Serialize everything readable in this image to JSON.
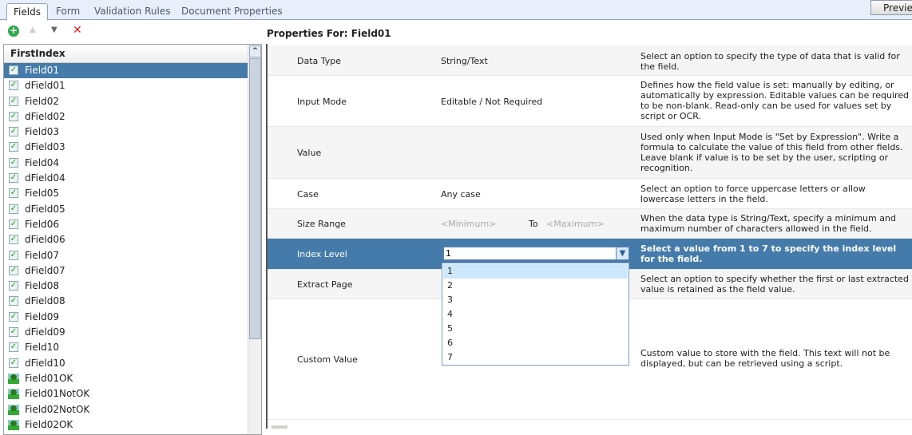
{
  "tabs": [
    {
      "label": "Fields",
      "active": true
    },
    {
      "label": "Form"
    },
    {
      "label": "Validation Rules"
    },
    {
      "label": "Document Properties"
    }
  ],
  "preview_label": "Preview",
  "toolbar": {
    "add": "add-icon",
    "up": "move-up-icon",
    "down": "move-down-icon",
    "delete": "delete-icon"
  },
  "list": {
    "header": "FirstIndex",
    "items": [
      {
        "label": "Field01",
        "type": "check",
        "selected": true
      },
      {
        "label": "dField01",
        "type": "check"
      },
      {
        "label": "Field02",
        "type": "check"
      },
      {
        "label": "dField02",
        "type": "check"
      },
      {
        "label": "Field03",
        "type": "check"
      },
      {
        "label": "dField03",
        "type": "check"
      },
      {
        "label": "Field04",
        "type": "check"
      },
      {
        "label": "dField04",
        "type": "check"
      },
      {
        "label": "Field05",
        "type": "check"
      },
      {
        "label": "dField05",
        "type": "check"
      },
      {
        "label": "Field06",
        "type": "check"
      },
      {
        "label": "dField06",
        "type": "check"
      },
      {
        "label": "Field07",
        "type": "check"
      },
      {
        "label": "dField07",
        "type": "check"
      },
      {
        "label": "Field08",
        "type": "check"
      },
      {
        "label": "dField08",
        "type": "check"
      },
      {
        "label": "Field09",
        "type": "check"
      },
      {
        "label": "dField09",
        "type": "check"
      },
      {
        "label": "Field10",
        "type": "check"
      },
      {
        "label": "dField10",
        "type": "check"
      },
      {
        "label": "Field01OK",
        "type": "tree"
      },
      {
        "label": "Field01NotOK",
        "type": "tree"
      },
      {
        "label": "Field02NotOK",
        "type": "tree"
      },
      {
        "label": "Field02OK",
        "type": "tree"
      }
    ]
  },
  "properties": {
    "title": "Properties For: Field01",
    "rows": [
      {
        "label": "Data Type",
        "value": "String/Text",
        "desc": "Select an option to specify the type of data that is valid for the field."
      },
      {
        "label": "Input Mode",
        "value": "Editable / Not Required",
        "desc": "Defines how the field value is set: manually by editing, or automatically by expression. Editable values can be required to be non-blank. Read-only can be used for values set by script or OCR."
      },
      {
        "label": "Value",
        "value": "",
        "desc": "Used only when Input Mode is \"Set by Expression\".  Write a formula to calculate the value of this field from other fields. Leave blank if value is to be set by the user, scripting or recognition."
      },
      {
        "label": "Case",
        "value": "Any case",
        "desc": "Select an option to force uppercase letters or allow lowercase letters in the field."
      },
      {
        "label": "Size Range",
        "min_placeholder": "<Minimum>",
        "to": "To",
        "max_placeholder": "<Maximum>",
        "desc": "When the data type is String/Text, specify a  minimum and maximum number of characters allowed in the field."
      },
      {
        "label": "Index Level",
        "value": "1",
        "desc": "Select a value from 1 to 7 to specify the index level for the field."
      },
      {
        "label": "Extract Page",
        "value": "",
        "desc": "Select an option to specify whether the first or last extracted value is retained as the field value."
      },
      {
        "label": "Custom Value",
        "value": "",
        "desc": "Custom value to store with the field.  This text will not be displayed, but can be retrieved using a script."
      }
    ]
  },
  "index_options": [
    "1",
    "2",
    "3",
    "4",
    "5",
    "6",
    "7"
  ]
}
